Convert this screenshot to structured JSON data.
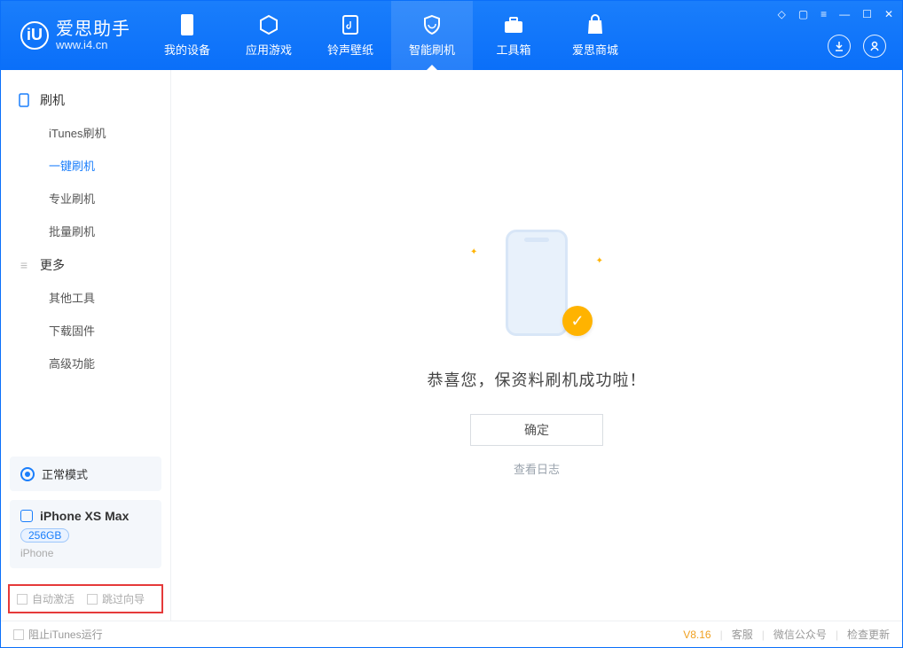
{
  "app": {
    "name": "爱思助手",
    "url": "www.i4.cn"
  },
  "nav": {
    "items": [
      {
        "label": "我的设备"
      },
      {
        "label": "应用游戏"
      },
      {
        "label": "铃声壁纸"
      },
      {
        "label": "智能刷机"
      },
      {
        "label": "工具箱"
      },
      {
        "label": "爱思商城"
      }
    ],
    "active_index": 3
  },
  "sidebar": {
    "group1": {
      "title": "刷机"
    },
    "items1": [
      {
        "label": "iTunes刷机"
      },
      {
        "label": "一键刷机"
      },
      {
        "label": "专业刷机"
      },
      {
        "label": "批量刷机"
      }
    ],
    "active1_index": 1,
    "group2": {
      "title": "更多"
    },
    "items2": [
      {
        "label": "其他工具"
      },
      {
        "label": "下载固件"
      },
      {
        "label": "高级功能"
      }
    ]
  },
  "device": {
    "mode": "正常模式",
    "name": "iPhone XS Max",
    "capacity": "256GB",
    "type": "iPhone"
  },
  "options": {
    "auto_activate": "自动激活",
    "skip_guide": "跳过向导"
  },
  "main": {
    "message": "恭喜您，保资料刷机成功啦！",
    "ok": "确定",
    "view_log": "查看日志"
  },
  "footer": {
    "block_itunes": "阻止iTunes运行",
    "version": "V8.16",
    "links": {
      "service": "客服",
      "wechat": "微信公众号",
      "update": "检查更新"
    }
  }
}
